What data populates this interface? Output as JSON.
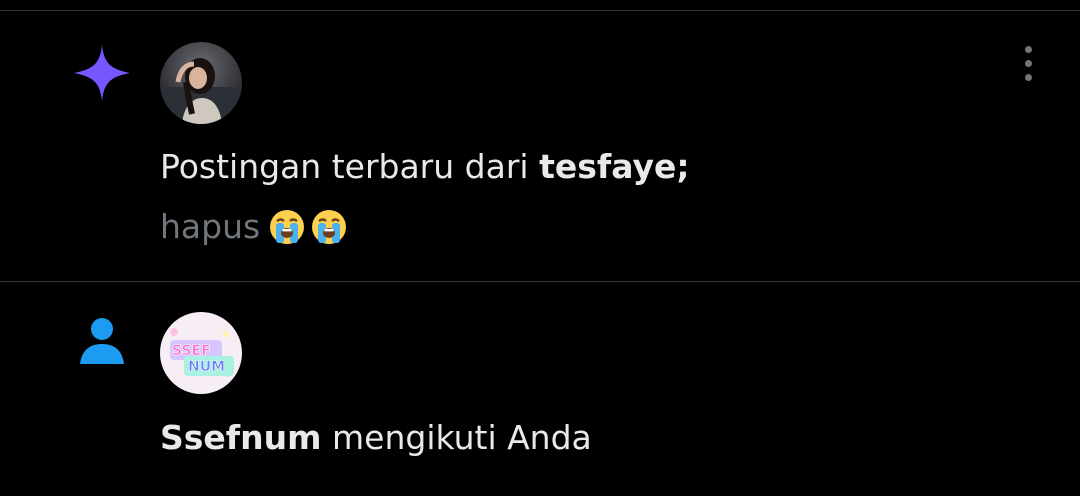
{
  "colors": {
    "background": "#000000",
    "divider": "#2f3336",
    "text_primary": "#e7e9ea",
    "text_secondary": "#71767b",
    "sparkle_purple": "#7856ff",
    "person_blue": "#1d9bf0"
  },
  "notifications": [
    {
      "type_icon": "sparkle-icon",
      "avatar": "user-photo-avatar",
      "text_prefix": "Postingan terbaru dari ",
      "text_bold": "tesfaye;",
      "preview_text": "hapus",
      "preview_emojis": [
        "loudly-crying-face-emoji",
        "loudly-crying-face-emoji"
      ],
      "more_icon": "more-vertical-icon"
    },
    {
      "type_icon": "person-icon",
      "avatar": "ssefnum-logo-avatar",
      "avatar_text": "SSEF NUM",
      "text_bold": "Ssefnum",
      "text_suffix": " mengikuti Anda"
    }
  ]
}
